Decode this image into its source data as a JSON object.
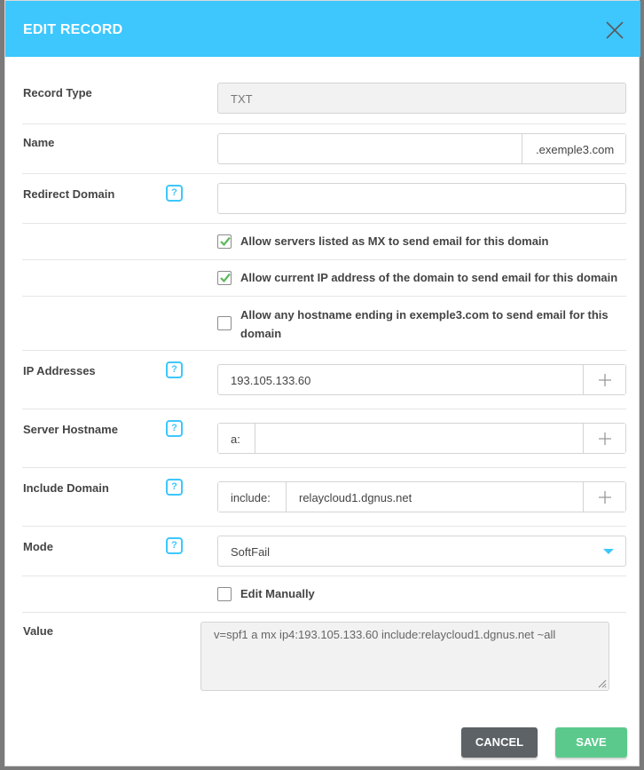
{
  "dialog": {
    "title": "EDIT RECORD"
  },
  "record_type": {
    "label": "Record Type",
    "value": "TXT"
  },
  "name": {
    "label": "Name",
    "value": "",
    "suffix": ".exemple3.com"
  },
  "redirect_domain": {
    "label": "Redirect Domain",
    "value": ""
  },
  "help_icon_text": "?",
  "options": [
    {
      "label": "Allow servers listed as MX to send email for this domain",
      "checked": true
    },
    {
      "label": "Allow current IP address of the domain to send email for this domain",
      "checked": true
    },
    {
      "label_line1": "Allow any hostname ending in exemple3.com to send email for this",
      "label_line2": "domain",
      "checked": false
    }
  ],
  "ip_addresses": {
    "label": "IP Addresses",
    "value": "193.105.133.60"
  },
  "server_hostname": {
    "label": "Server Hostname",
    "prefix": "a:",
    "value": ""
  },
  "include_domain": {
    "label": "Include Domain",
    "prefix": "include:",
    "value": "relaycloud1.dgnus.net"
  },
  "mode": {
    "label": "Mode",
    "selected": "SoftFail"
  },
  "edit_manually": {
    "label": "Edit Manually",
    "checked": false
  },
  "value": {
    "label": "Value",
    "text": "v=spf1 a mx ip4:193.105.133.60 include:relaycloud1.dgnus.net ~all"
  },
  "buttons": {
    "cancel": "CANCEL",
    "save": "SAVE"
  },
  "colors": {
    "header": "#3dc7fd",
    "accent": "#3dc7fd",
    "cancel": "#5c6266",
    "save": "#5cc98c",
    "check": "#5cb85c"
  }
}
